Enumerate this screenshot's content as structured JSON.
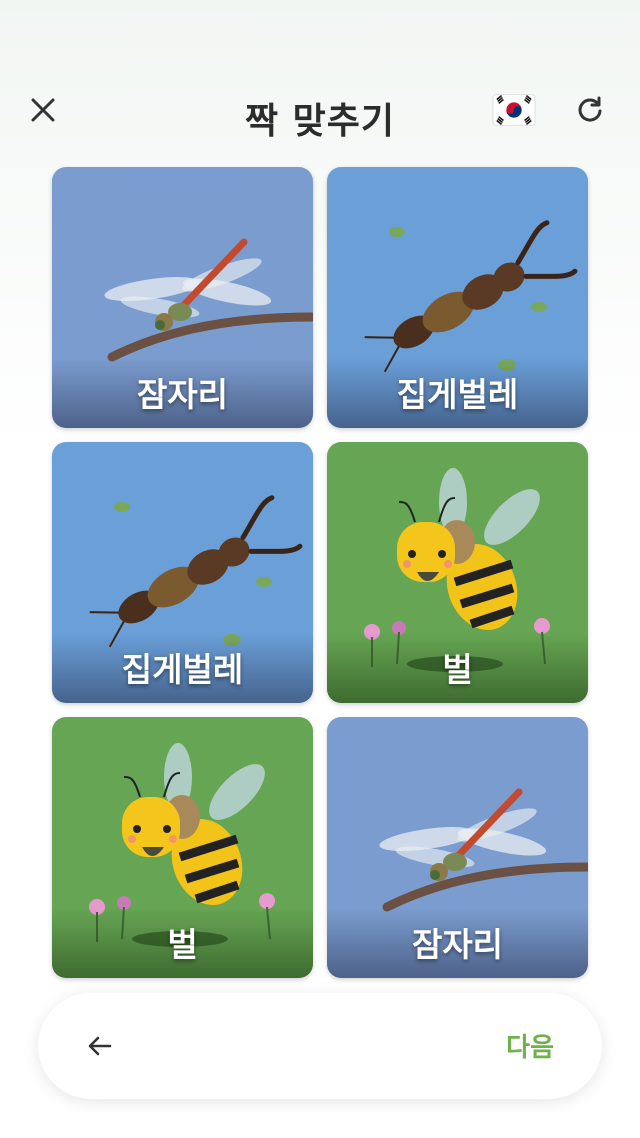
{
  "header": {
    "title": "짝 맞추기",
    "close_icon": "close-icon",
    "flag_icon": "korea-flag-icon",
    "refresh_icon": "refresh-icon"
  },
  "cards": [
    {
      "label": "잠자리",
      "image": "dragonfly",
      "background": "#7b9ccf"
    },
    {
      "label": "집게벌레",
      "image": "earwig",
      "background": "#6a9fd8"
    },
    {
      "label": "집게벌레",
      "image": "earwig",
      "background": "#6a9fd8"
    },
    {
      "label": "벌",
      "image": "bee",
      "background": "#66a553"
    },
    {
      "label": "벌",
      "image": "bee",
      "background": "#66a553"
    },
    {
      "label": "잠자리",
      "image": "dragonfly",
      "background": "#7b9ccf"
    }
  ],
  "bottom_bar": {
    "back_icon": "arrow-left-icon",
    "next_label": "다음"
  },
  "colors": {
    "accent": "#6fb24a",
    "title": "#2c2c2c"
  }
}
